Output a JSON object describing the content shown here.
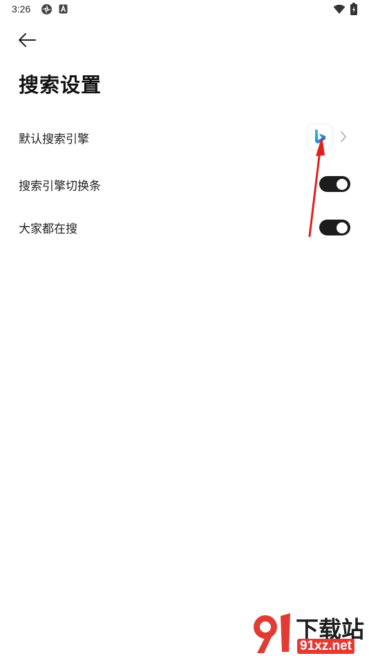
{
  "status_bar": {
    "time": "3:26",
    "icons": [
      "aperture-icon",
      "a-notification-icon",
      "wifi-icon",
      "battery-charging-icon"
    ]
  },
  "header": {
    "back_icon": "arrow-left-icon",
    "title": "搜索设置"
  },
  "settings": {
    "default_engine": {
      "label": "默认搜索引擎",
      "engine_icon": "bing-logo-icon",
      "chevron_icon": "chevron-right-icon"
    },
    "engine_switch_bar": {
      "label": "搜索引擎切换条",
      "enabled": true
    },
    "trending_searches": {
      "label": "大家都在搜",
      "enabled": true
    }
  },
  "annotation": {
    "arrow_color": "#e0201b"
  },
  "watermark": {
    "brand": "下载站",
    "url": "91xz.net",
    "logo_color": "#e23b34"
  },
  "colors": {
    "toggle_on": "#1c1c1c",
    "text": "#222222",
    "background": "#ffffff"
  }
}
